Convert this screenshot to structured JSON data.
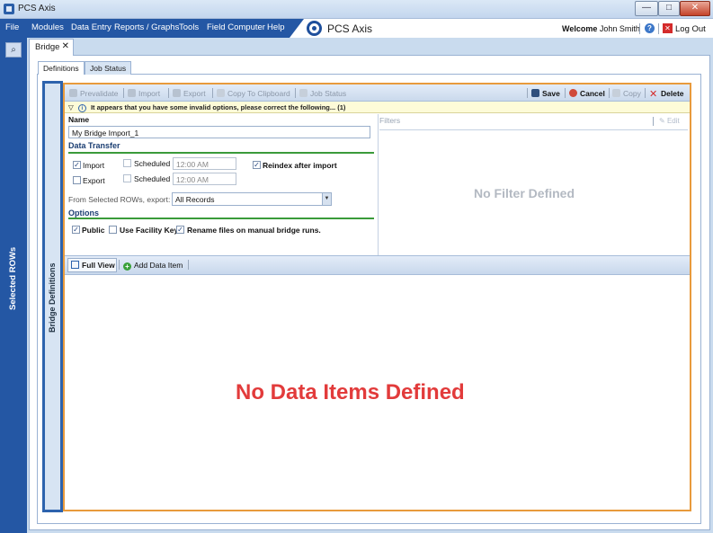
{
  "window": {
    "title": "PCS Axis",
    "min": "—",
    "max": "□",
    "close": "✕"
  },
  "menu": {
    "items": [
      "File",
      "Modules",
      "Data Entry",
      "Reports / Graphs",
      "Tools",
      "Field Computer",
      "Help"
    ],
    "logo_text": "PCS Axis",
    "welcome_label": "Welcome",
    "user_name": "John Smith",
    "logout_label": "Log Out"
  },
  "sidebar": {
    "label": "Selected ROWs"
  },
  "document_tab": {
    "label": "Bridge"
  },
  "sub_tabs": {
    "definitions": "Definitions",
    "job_status": "Job Status"
  },
  "side_panel": {
    "label": "Bridge Definitions"
  },
  "toolbar": {
    "prevalidate": "Prevalidate",
    "import": "Import",
    "export": "Export",
    "copy_to_clipboard": "Copy To Clipboard",
    "job_status": "Job Status",
    "save": "Save",
    "cancel": "Cancel",
    "copy": "Copy",
    "delete": "Delete"
  },
  "warning": {
    "text": "It appears that you have some invalid options, please correct the following...  (1)"
  },
  "form": {
    "name_label": "Name",
    "name_value": "My Bridge Import_1",
    "data_transfer_heading": "Data Transfer",
    "import_label": "Import",
    "import_checked": true,
    "export_label": "Export",
    "export_checked": false,
    "scheduled_label": "Scheduled",
    "scheduled_import_checked": false,
    "scheduled_export_checked": false,
    "scheduled_time_1": "12:00 AM",
    "scheduled_time_2": "12:00 AM",
    "reindex_label": "Reindex after import",
    "reindex_checked": true,
    "export_from_label": "From Selected ROWs, export:",
    "export_from_value": "All Records",
    "options_heading": "Options",
    "public_label": "Public",
    "public_checked": true,
    "facility_key_label": "Use Facility Key",
    "facility_key_checked": false,
    "rename_label": "Rename files on manual bridge runs.",
    "rename_checked": true
  },
  "filters": {
    "heading": "Filters",
    "edit_label": "Edit",
    "empty_text": "No Filter Defined"
  },
  "data_items": {
    "full_view_label": "Full View",
    "add_label": "Add Data Item",
    "empty_text": "No Data Items Defined"
  },
  "colors": {
    "menu_bar": "#2457a4",
    "accent_orange": "#e89a3c",
    "section_line": "#3a9b3a",
    "empty_data_text": "#e23b3b"
  }
}
